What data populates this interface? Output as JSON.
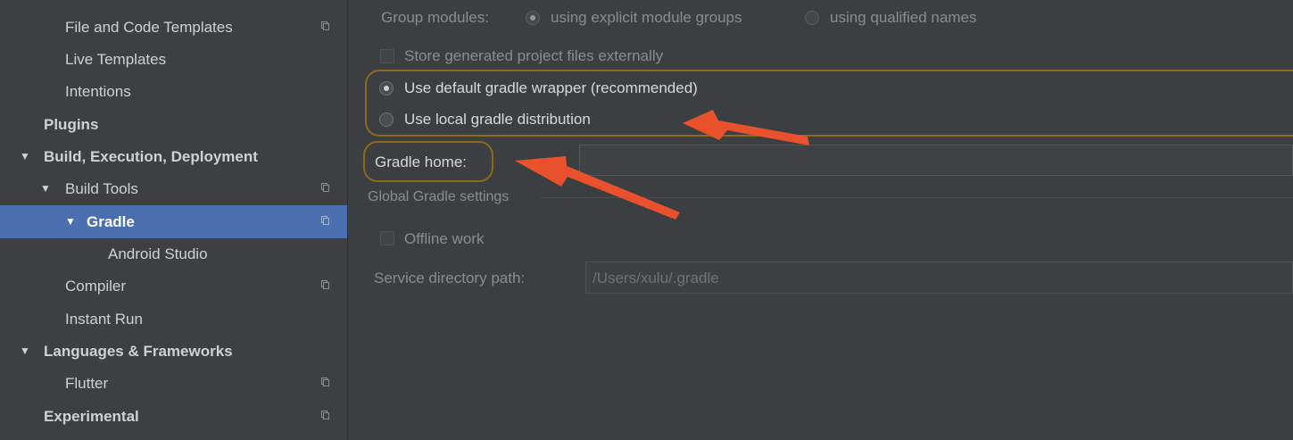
{
  "sidebar": {
    "items": [
      {
        "label": "File and Code Templates",
        "bold": false,
        "arrow": "",
        "has_config": true,
        "selected": false
      },
      {
        "label": "Live Templates",
        "bold": false,
        "arrow": "",
        "has_config": false,
        "selected": false
      },
      {
        "label": "Intentions",
        "bold": false,
        "arrow": "",
        "has_config": false,
        "selected": false
      },
      {
        "label": "Plugins",
        "bold": true,
        "arrow": "",
        "has_config": false,
        "selected": false
      },
      {
        "label": "Build, Execution, Deployment",
        "bold": true,
        "arrow": "▼",
        "has_config": false,
        "selected": false
      },
      {
        "label": "Build Tools",
        "bold": false,
        "arrow": "▼",
        "has_config": true,
        "selected": false
      },
      {
        "label": "Gradle",
        "bold": false,
        "arrow": "▼",
        "has_config": true,
        "selected": true
      },
      {
        "label": "Android Studio",
        "bold": false,
        "arrow": "",
        "has_config": false,
        "selected": false
      },
      {
        "label": "Compiler",
        "bold": false,
        "arrow": "",
        "has_config": true,
        "selected": false
      },
      {
        "label": "Instant Run",
        "bold": false,
        "arrow": "",
        "has_config": false,
        "selected": false
      },
      {
        "label": "Languages & Frameworks",
        "bold": true,
        "arrow": "▼",
        "has_config": false,
        "selected": false
      },
      {
        "label": "Flutter",
        "bold": false,
        "arrow": "",
        "has_config": true,
        "selected": false
      },
      {
        "label": "Experimental",
        "bold": true,
        "arrow": "",
        "has_config": true,
        "selected": false
      }
    ]
  },
  "main": {
    "group_modules": {
      "label": "Group modules:",
      "option_explicit": "using explicit module groups",
      "option_qualified": "using qualified names",
      "selected": "explicit"
    },
    "store_generated": {
      "label": "Store generated project files externally",
      "checked": false
    },
    "gradle_wrapper": {
      "default_label": "Use default gradle wrapper (recommended)",
      "local_label": "Use local gradle distribution",
      "selected": "default"
    },
    "gradle_home": {
      "label": "Gradle home:",
      "value": ""
    },
    "global_section_title": "Global Gradle settings",
    "offline_work": {
      "label": "Offline work",
      "checked": false
    },
    "service_directory": {
      "label": "Service directory path:",
      "value": "/Users/xulu/.gradle"
    }
  },
  "colors": {
    "sidebar_bg": "#3d3f41",
    "main_bg": "#3c3f41",
    "selection": "#4b6eaf",
    "highlight_outline": "#8a6a1e",
    "annotation_arrow": "#e8512b"
  }
}
